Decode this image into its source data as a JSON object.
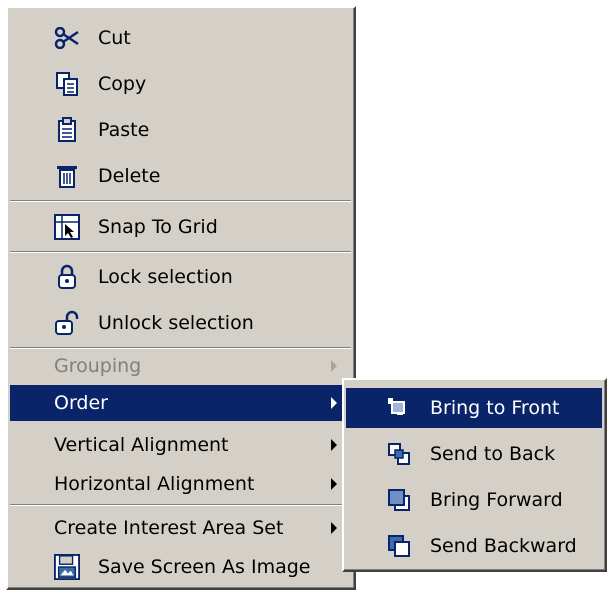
{
  "menu": {
    "items": [
      {
        "label": "Cut",
        "icon": "scissors-icon"
      },
      {
        "label": "Copy",
        "icon": "copy-icon"
      },
      {
        "label": "Paste",
        "icon": "paste-icon"
      },
      {
        "label": "Delete",
        "icon": "trash-icon"
      },
      {
        "label": "Snap To Grid",
        "icon": "snap-grid-icon"
      },
      {
        "label": "Lock selection",
        "icon": "lock-icon"
      },
      {
        "label": "Unlock selection",
        "icon": "unlock-icon"
      },
      {
        "label": "Grouping",
        "disabled": true,
        "submenu": true
      },
      {
        "label": "Order",
        "selected": true,
        "submenu": true
      },
      {
        "label": "Vertical Alignment",
        "submenu": true
      },
      {
        "label": "Horizontal Alignment",
        "submenu": true
      },
      {
        "label": "Create Interest Area Set",
        "submenu": true
      },
      {
        "label": "Save Screen As Image",
        "icon": "save-image-icon"
      }
    ]
  },
  "submenu": {
    "items": [
      {
        "label": "Bring to Front",
        "icon": "bring-to-front-icon",
        "selected": true
      },
      {
        "label": "Send to Back",
        "icon": "send-to-back-icon"
      },
      {
        "label": "Bring Forward",
        "icon": "bring-forward-icon"
      },
      {
        "label": "Send Backward",
        "icon": "send-backward-icon"
      }
    ]
  },
  "colors": {
    "menu_bg": "#d4d0c8",
    "highlight": "#0a246a",
    "highlight_text": "#ffffff",
    "disabled_text": "#808080"
  }
}
